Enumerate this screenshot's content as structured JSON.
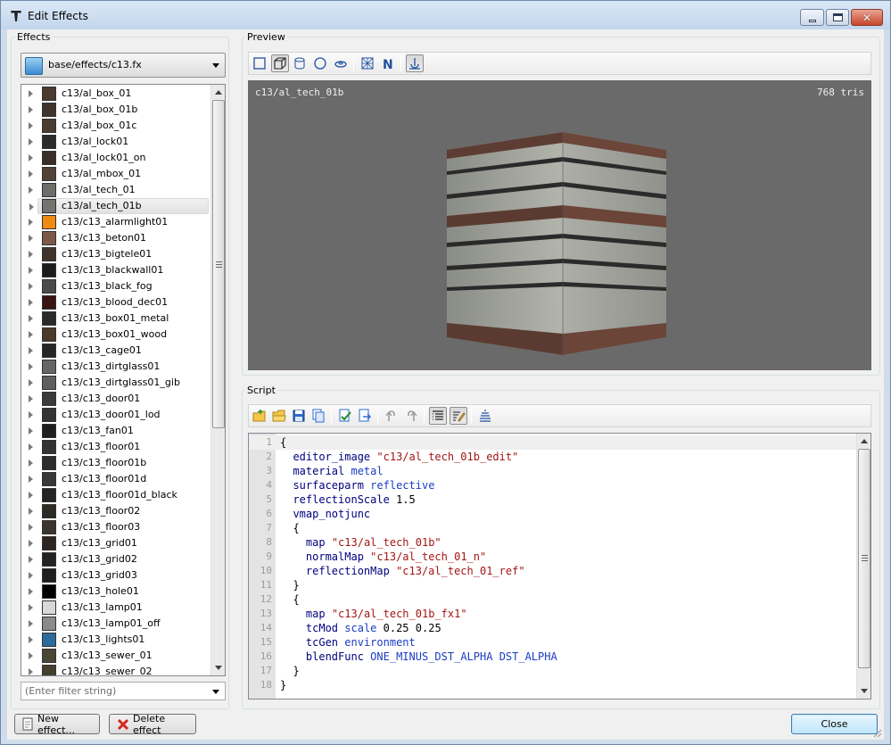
{
  "window": {
    "title": "Edit Effects"
  },
  "effects_panel": {
    "label": "Effects",
    "file_selector": "base/effects/c13.fx",
    "filter_placeholder": "(Enter filter string)",
    "items": [
      {
        "label": "c13/al_box_01",
        "color": "#4a3a30"
      },
      {
        "label": "c13/al_box_01b",
        "color": "#3f352c"
      },
      {
        "label": "c13/al_box_01c",
        "color": "#4b3c31"
      },
      {
        "label": "c13/al_lock01",
        "color": "#2b2b2b"
      },
      {
        "label": "c13/al_lock01_on",
        "color": "#3a2f28"
      },
      {
        "label": "c13/al_mbox_01",
        "color": "#524236"
      },
      {
        "label": "c13/al_tech_01",
        "color": "#6d6d6a"
      },
      {
        "label": "c13/al_tech_01b",
        "color": "#73736f",
        "selected": true
      },
      {
        "label": "c13/c13_alarmlight01",
        "color": "#f08a12"
      },
      {
        "label": "c13/c13_beton01",
        "color": "#7d5a48"
      },
      {
        "label": "c13/c13_bigtele01",
        "color": "#3f342b"
      },
      {
        "label": "c13/c13_blackwall01",
        "color": "#1c1c1c"
      },
      {
        "label": "c13/c13_black_fog",
        "color": "#4a4a4a"
      },
      {
        "label": "c13/c13_blood_dec01",
        "color": "#3a1313"
      },
      {
        "label": "c13/c13_box01_metal",
        "color": "#2a2a2a"
      },
      {
        "label": "c13/c13_box01_wood",
        "color": "#4c3a2a"
      },
      {
        "label": "c13/c13_cage01",
        "color": "#262626"
      },
      {
        "label": "c13/c13_dirtglass01",
        "color": "#666"
      },
      {
        "label": "c13/c13_dirtglass01_gib",
        "color": "#5e5e5e"
      },
      {
        "label": "c13/c13_door01",
        "color": "#3a3a3a"
      },
      {
        "label": "c13/c13_door01_lod",
        "color": "#353535"
      },
      {
        "label": "c13/c13_fan01",
        "color": "#1e1e1e"
      },
      {
        "label": "c13/c13_floor01",
        "color": "#333"
      },
      {
        "label": "c13/c13_floor01b",
        "color": "#2c2c2c"
      },
      {
        "label": "c13/c13_floor01d",
        "color": "#383838"
      },
      {
        "label": "c13/c13_floor01d_black",
        "color": "#242424"
      },
      {
        "label": "c13/c13_floor02",
        "color": "#2e2a26"
      },
      {
        "label": "c13/c13_floor03",
        "color": "#3b3530"
      },
      {
        "label": "c13/c13_grid01",
        "color": "#2c2622"
      },
      {
        "label": "c13/c13_grid02",
        "color": "#232323"
      },
      {
        "label": "c13/c13_grid03",
        "color": "#1f1f1f"
      },
      {
        "label": "c13/c13_hole01",
        "color": "#000"
      },
      {
        "label": "c13/c13_lamp01",
        "color": "#d8d8d8"
      },
      {
        "label": "c13/c13_lamp01_off",
        "color": "#8a8a8a"
      },
      {
        "label": "c13/c13_lights01",
        "color": "#2b6c9c"
      },
      {
        "label": "c13/c13_sewer_01",
        "color": "#4a4636"
      },
      {
        "label": "c13/c13_sewer_02",
        "color": "#44402f"
      }
    ]
  },
  "preview": {
    "label": "Preview",
    "effect_name": "c13/al_tech_01b",
    "triangle_count": "768 tris"
  },
  "script": {
    "label": "Script",
    "lines": [
      {
        "n": "1",
        "text": "{"
      },
      {
        "n": "2",
        "text": "  editor_image \"c13/al_tech_01b_edit\""
      },
      {
        "n": "3",
        "text": "  material metal"
      },
      {
        "n": "4",
        "text": "  surfaceparm reflective"
      },
      {
        "n": "5",
        "text": "  reflectionScale 1.5"
      },
      {
        "n": "6",
        "text": "  vmap_notjunc"
      },
      {
        "n": "7",
        "text": "  {"
      },
      {
        "n": "8",
        "text": "    map \"c13/al_tech_01b\""
      },
      {
        "n": "9",
        "text": "    normalMap \"c13/al_tech_01_n\""
      },
      {
        "n": "10",
        "text": "    reflectionMap \"c13/al_tech_01_ref\""
      },
      {
        "n": "11",
        "text": "  }"
      },
      {
        "n": "12",
        "text": "  {"
      },
      {
        "n": "13",
        "text": "    map \"c13/al_tech_01b_fx1\""
      },
      {
        "n": "14",
        "text": "    tcMod scale 0.25 0.25"
      },
      {
        "n": "15",
        "text": "    tcGen environment"
      },
      {
        "n": "16",
        "text": "    blendFunc ONE_MINUS_DST_ALPHA DST_ALPHA"
      },
      {
        "n": "17",
        "text": "  }"
      },
      {
        "n": "18",
        "text": "}"
      }
    ]
  },
  "buttons": {
    "new_effect": "New effect...",
    "delete_effect": "Delete effect",
    "close": "Close"
  }
}
